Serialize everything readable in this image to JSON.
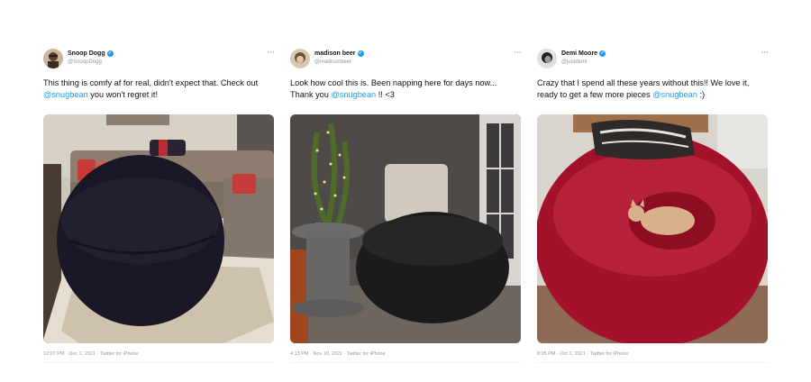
{
  "tweets": [
    {
      "name": "Snoop Dogg",
      "handle": "@SnoopDogg",
      "text_before": "This thing is comfy af for real, didn't expect that. Check out ",
      "mention": "@snugbean",
      "text_after": " you won't regret it!",
      "meta": "12:07 PM · Dec 1, 2021 · Twitter for iPhone",
      "more": "···",
      "verified": true,
      "photo_icon": "black-beanbag-living-room",
      "avatar_icon": "snoop-avatar"
    },
    {
      "name": "madison beer",
      "handle": "@madisonbeer",
      "text_before": "Look how cool this is. Been napping here for days now... Thank you ",
      "mention": "@snugbean",
      "text_after": " !! <3",
      "meta": "4:13 PM · Nov 10, 2021 · Twitter for iPhone",
      "more": "···",
      "verified": true,
      "photo_icon": "black-beanbag-plant-corner",
      "avatar_icon": "madison-avatar"
    },
    {
      "name": "Demi Moore",
      "handle": "@justdemi",
      "text_before": "Crazy that I spend all these years without this!! We love it, ready to get a few more pieces ",
      "mention": "@snugbean",
      "text_after": " :)",
      "meta": "8:05 PM · Oct 1, 2021 · Twitter for iPhone",
      "more": "···",
      "verified": true,
      "photo_icon": "red-beanbag-with-cat",
      "avatar_icon": "demi-avatar"
    }
  ],
  "colors": {
    "link": "#1d9bf0",
    "muted": "#8b98a5"
  }
}
